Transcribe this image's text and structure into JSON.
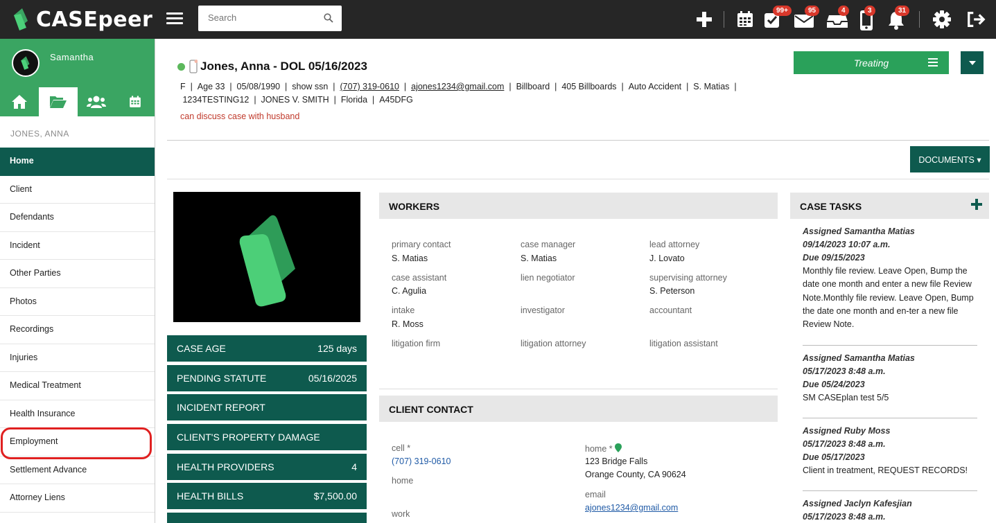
{
  "app": {
    "logo_text": "CASEpeer"
  },
  "topbar": {
    "search_placeholder": "Search",
    "badges": {
      "tasks": "99+",
      "mail": "95",
      "inbox": "4",
      "phone": "3",
      "bell": "31"
    }
  },
  "sidebar": {
    "user_name": "Samantha",
    "case_name": "JONES, ANNA",
    "items": [
      {
        "label": "Home"
      },
      {
        "label": "Client"
      },
      {
        "label": "Defendants"
      },
      {
        "label": "Incident"
      },
      {
        "label": "Other Parties"
      },
      {
        "label": "Photos"
      },
      {
        "label": "Recordings"
      },
      {
        "label": "Injuries"
      },
      {
        "label": "Medical Treatment"
      },
      {
        "label": "Health Insurance"
      },
      {
        "label": "Employment"
      },
      {
        "label": "Settlement Advance"
      },
      {
        "label": "Attorney Liens"
      }
    ]
  },
  "case": {
    "title": "Jones, Anna - DOL 05/16/2023",
    "info": {
      "gender": "F",
      "age": "Age 33",
      "dob": "05/08/1990",
      "ssn": "show ssn",
      "phone": "(707) 319-0610",
      "email": "ajones1234@gmail.com",
      "source": "Billboard",
      "source_detail": "405 Billboards",
      "case_type": "Auto Accident",
      "attorney": "S. Matias",
      "case_number": "1234TESTING12",
      "caption": "JONES V. SMITH",
      "state": "Florida",
      "code": "A45DFG"
    },
    "note": "can discuss case with husband",
    "status_label": "Treating",
    "documents_label": "DOCUMENTS ▾"
  },
  "stats": [
    {
      "label": "CASE AGE",
      "value": "125 days"
    },
    {
      "label": "PENDING STATUTE",
      "value": "05/16/2025"
    },
    {
      "label": "INCIDENT REPORT",
      "value": ""
    },
    {
      "label": "CLIENT'S PROPERTY DAMAGE",
      "value": ""
    },
    {
      "label": "HEALTH PROVIDERS",
      "value": "4"
    },
    {
      "label": "HEALTH BILLS",
      "value": "$7,500.00"
    }
  ],
  "workers": {
    "title": "WORKERS",
    "fields": [
      {
        "label": "primary contact",
        "value": "S. Matias"
      },
      {
        "label": "case manager",
        "value": "S. Matias"
      },
      {
        "label": "lead attorney",
        "value": "J. Lovato"
      },
      {
        "label": "case assistant",
        "value": "C. Agulia"
      },
      {
        "label": "lien negotiator",
        "value": ""
      },
      {
        "label": "supervising attorney",
        "value": "S. Peterson"
      },
      {
        "label": "intake",
        "value": "R. Moss"
      },
      {
        "label": "investigator",
        "value": ""
      },
      {
        "label": "accountant",
        "value": ""
      },
      {
        "label": "litigation firm",
        "value": ""
      },
      {
        "label": "litigation attorney",
        "value": ""
      },
      {
        "label": "litigation assistant",
        "value": ""
      }
    ]
  },
  "client_contact": {
    "title": "CLIENT CONTACT",
    "cell_label": "cell *",
    "cell_value": "(707) 319-0610",
    "home_phone_label": "home",
    "work_label": "work",
    "home_addr_label": "home *",
    "address_line1": "123 Bridge Falls",
    "address_line2": "Orange County, CA 90624",
    "email_label": "email",
    "email_value": "ajones1234@gmail.com"
  },
  "tasks": {
    "title": "CASE TASKS",
    "items": [
      {
        "assigned": "Assigned Samantha Matias",
        "created": "09/14/2023 10:07 a.m.",
        "due": "Due 09/15/2023",
        "desc": "Monthly file review. Leave Open, Bump the date one month and enter a new file Review Note.Monthly file review. Leave Open, Bump the date one month and en-ter a new file Review Note."
      },
      {
        "assigned": "Assigned Samantha Matias",
        "created": "05/17/2023 8:48 a.m.",
        "due": "Due 05/24/2023",
        "desc": "SM CASEplan test 5/5"
      },
      {
        "assigned": "Assigned Ruby Moss",
        "created": "05/17/2023 8:48 a.m.",
        "due": "Due 05/17/2023",
        "desc": "Client in treatment, REQUEST RECORDS!"
      },
      {
        "assigned": "Assigned Jaclyn Kafesjian",
        "created": "05/17/2023 8:48 a.m.",
        "due": "",
        "desc": ""
      }
    ]
  },
  "colors": {
    "brand_green": "#3aa562",
    "dark_teal": "#0e5a4e",
    "topbar": "#262626",
    "badge_red": "#d9382b"
  }
}
